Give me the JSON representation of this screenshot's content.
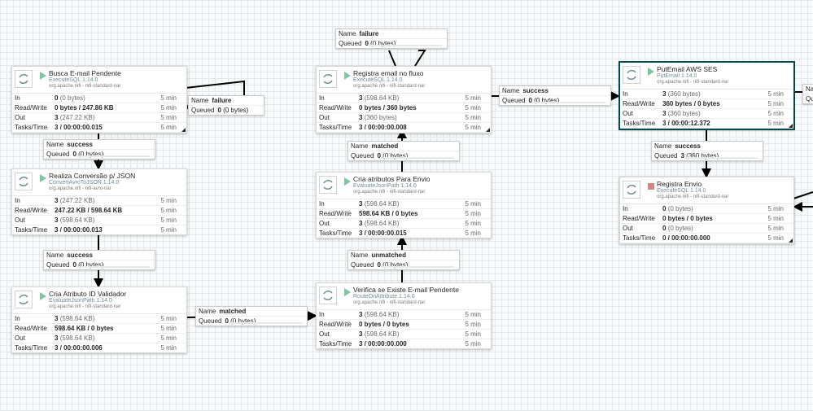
{
  "labels": {
    "in": "In",
    "read_write": "Read/Write",
    "out": "Out",
    "tasks_time": "Tasks/Time",
    "name": "Name",
    "queued": "Queued"
  },
  "colors": {
    "running": "#7dc7a0",
    "stopped": "#d18686",
    "selected_border": "#004849",
    "type_text": "#728e9b"
  },
  "processors": {
    "busca": {
      "name": "Busca E-mail Pendente",
      "type": "ExecuteSQL 1.14.0",
      "bundle": "org.apache.nifi - nifi-standard-nar",
      "status_icon": "play-icon",
      "in_n": "0",
      "in_p": "(0 bytes)",
      "in_t": "5 min",
      "rw": "0 bytes / 247.86 KB",
      "rw_t": "5 min",
      "out_n": "3",
      "out_p": "(247.22 KB)",
      "out_t": "5 min",
      "tt": "3 / 00:00:00.015",
      "tt_t": "5 min"
    },
    "conversao": {
      "name": "Realiza Conversão p/ JSON",
      "type": "ConvertAvroToJSON 1.14.0",
      "bundle": "org.apache.nifi - nifi-avro-nar",
      "status_icon": "play-icon",
      "in_n": "3",
      "in_p": "(247.22 KB)",
      "in_t": "5 min",
      "rw": "247.22 KB / 598.64 KB",
      "rw_t": "5 min",
      "out_n": "3",
      "out_p": "(598.64 KB)",
      "out_t": "5 min",
      "tt": "3 / 00:00:00.013",
      "tt_t": "5 min"
    },
    "validador": {
      "name": "Cria Atributo ID Validador",
      "type": "EvaluateJsonPath 1.14.0",
      "bundle": "org.apache.nifi - nifi-standard-nar",
      "status_icon": "play-icon",
      "in_n": "3",
      "in_p": "(598.64 KB)",
      "in_t": "5 min",
      "rw": "598.64 KB / 0 bytes",
      "rw_t": "5 min",
      "out_n": "3",
      "out_p": "(598.64 KB)",
      "out_t": "5 min",
      "tt": "3 / 00:00:00.006",
      "tt_t": "5 min"
    },
    "registra_email": {
      "name": "Registra email no fluxo",
      "type": "ExecuteSQL 1.14.0",
      "bundle": "org.apache.nifi - nifi-standard-nar",
      "status_icon": "play-icon",
      "in_n": "3",
      "in_p": "(598.64 KB)",
      "in_t": "5 min",
      "rw": "0 bytes / 360 bytes",
      "rw_t": "5 min",
      "out_n": "3",
      "out_p": "(360 bytes)",
      "out_t": "5 min",
      "tt": "3 / 00:00:00.008",
      "tt_t": "5 min"
    },
    "atributos": {
      "name": "Cria atributos Para Envio",
      "type": "EvaluateJsonPath 1.14.0",
      "bundle": "org.apache.nifi - nifi-standard-nar",
      "status_icon": "play-icon",
      "in_n": "3",
      "in_p": "(598.64 KB)",
      "in_t": "5 min",
      "rw": "598.64 KB / 0 bytes",
      "rw_t": "5 min",
      "out_n": "3",
      "out_p": "(598.64 KB)",
      "out_t": "5 min",
      "tt": "3 / 00:00:00.015",
      "tt_t": "5 min"
    },
    "verifica": {
      "name": "Verifica se Existe E-mail Pendente",
      "type": "RouteOnAttribute 1.14.0",
      "bundle": "org.apache.nifi - nifi-standard-nar",
      "status_icon": "play-icon",
      "in_n": "3",
      "in_p": "(598.64 KB)",
      "in_t": "5 min",
      "rw": "0 bytes / 0 bytes",
      "rw_t": "5 min",
      "out_n": "3",
      "out_p": "(598.64 KB)",
      "out_t": "5 min",
      "tt": "3 / 00:00:00.000",
      "tt_t": "5 min"
    },
    "putemail": {
      "name": "PutEmail AWS SES",
      "type": "PutEmail 1.14.0",
      "bundle": "org.apache.nifi - nifi-standard-nar",
      "status_icon": "play-icon",
      "in_n": "3",
      "in_p": "(360 bytes)",
      "in_t": "5 min",
      "rw": "360 bytes / 0 bytes",
      "rw_t": "5 min",
      "out_n": "3",
      "out_p": "(360 bytes)",
      "out_t": "5 min",
      "tt": "3 / 00:00:12.372",
      "tt_t": "5 min"
    },
    "registra_envio": {
      "name": "Registra Envio",
      "type": "ExecuteSQL 1.14.0",
      "bundle": "org.apache.nifi - nifi-standard-nar",
      "status_icon": "stop-icon",
      "in_n": "0",
      "in_p": "(0 bytes)",
      "in_t": "5 min",
      "rw": "0 bytes / 0 bytes",
      "rw_t": "5 min",
      "out_n": "0",
      "out_p": "(0 bytes)",
      "out_t": "5 min",
      "tt": "0 / 00:00:00.000",
      "tt_t": "5 min"
    }
  },
  "connections": {
    "failure_busca": {
      "name": "failure",
      "queued_n": "0",
      "queued_p": "(0 bytes)"
    },
    "success_busca": {
      "name": "success",
      "queued_n": "0",
      "queued_p": "(0 bytes)"
    },
    "success_conversao": {
      "name": "success",
      "queued_n": "0",
      "queued_p": "(0 bytes)"
    },
    "matched_validador": {
      "name": "matched",
      "queued_n": "0",
      "queued_p": "(0 bytes)"
    },
    "unmatched_verifica": {
      "name": "unmatched",
      "queued_n": "0",
      "queued_p": "(0 bytes)"
    },
    "matched_atributos": {
      "name": "matched",
      "queued_n": "0",
      "queued_p": "(0 bytes)"
    },
    "failure_registra": {
      "name": "failure",
      "queued_n": "0",
      "queued_p": "(0 bytes)"
    },
    "success_registra": {
      "name": "success",
      "queued_n": "0",
      "queued_p": "(0 bytes)"
    },
    "success_put": {
      "name": "success",
      "queued_n": "3",
      "queued_p": "(360 bytes)"
    },
    "edge_right_name": "Na",
    "edge_right_queued": "Qu"
  }
}
